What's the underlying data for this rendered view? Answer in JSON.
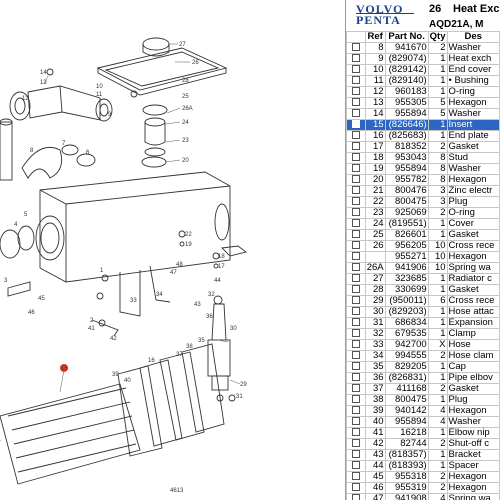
{
  "diagram": {
    "number": "4613",
    "callouts": [
      "27",
      "26",
      "28",
      "25",
      "26A",
      "24",
      "23",
      "20",
      "22",
      "19",
      "18",
      "17",
      "16",
      "15",
      "14",
      "13",
      "12",
      "11",
      "10",
      "9",
      "8",
      "7",
      "6",
      "5",
      "4",
      "3",
      "2",
      "1",
      "29",
      "30",
      "31",
      "32",
      "33",
      "34",
      "35",
      "36",
      "37",
      "38",
      "39",
      "40",
      "41",
      "42",
      "43",
      "44",
      "45",
      "46",
      "47",
      "48"
    ],
    "highlighted_callout": "15"
  },
  "brand": {
    "line1": "VOLVO",
    "line2": "PENTA"
  },
  "section": {
    "number": "26",
    "title": "Heat Exch",
    "subtitle": "AQD21A, M"
  },
  "columns": {
    "ref": "Ref",
    "part": "Part No.",
    "qty": "Qty",
    "desc": "Des"
  },
  "rows": [
    {
      "ref": "8",
      "part": "941670",
      "qty": "2",
      "desc": "Washer"
    },
    {
      "ref": "9",
      "part": "(829074)",
      "qty": "1",
      "desc": "Heat exch"
    },
    {
      "ref": "10",
      "part": "(829142)",
      "qty": "1",
      "desc": "End cover"
    },
    {
      "ref": "11",
      "part": "(829140)",
      "qty": "1",
      "desc": "• Bushing"
    },
    {
      "ref": "12",
      "part": "960183",
      "qty": "1",
      "desc": "O-ring"
    },
    {
      "ref": "13",
      "part": "955305",
      "qty": "5",
      "desc": "Hexagon"
    },
    {
      "ref": "14",
      "part": "955894",
      "qty": "5",
      "desc": "Washer"
    },
    {
      "ref": "15",
      "part": "(826646)",
      "qty": "1",
      "desc": "Insert",
      "selected": true
    },
    {
      "ref": "16",
      "part": "(825683)",
      "qty": "1",
      "desc": "End plate"
    },
    {
      "ref": "17",
      "part": "818352",
      "qty": "2",
      "desc": "Gasket"
    },
    {
      "ref": "18",
      "part": "953043",
      "qty": "8",
      "desc": "Stud"
    },
    {
      "ref": "19",
      "part": "955894",
      "qty": "8",
      "desc": "Washer"
    },
    {
      "ref": "20",
      "part": "955782",
      "qty": "8",
      "desc": "Hexagon"
    },
    {
      "ref": "21",
      "part": "800476",
      "qty": "3",
      "desc": "Zinc electr"
    },
    {
      "ref": "22",
      "part": "800475",
      "qty": "3",
      "desc": "Plug"
    },
    {
      "ref": "23",
      "part": "925069",
      "qty": "2",
      "desc": "O-ring"
    },
    {
      "ref": "24",
      "part": "(819551)",
      "qty": "1",
      "desc": "Cover"
    },
    {
      "ref": "25",
      "part": "826601",
      "qty": "1",
      "desc": "Gasket"
    },
    {
      "ref": "26",
      "part": "956205",
      "qty": "10",
      "desc": "Cross rece"
    },
    {
      "ref": "",
      "part": "955271",
      "qty": "10",
      "desc": "Hexagon"
    },
    {
      "ref": "26A",
      "part": "941906",
      "qty": "10",
      "desc": "Spring wa"
    },
    {
      "ref": "27",
      "part": "323685",
      "qty": "1",
      "desc": "Radiator c"
    },
    {
      "ref": "28",
      "part": "330699",
      "qty": "1",
      "desc": "Gasket"
    },
    {
      "ref": "29",
      "part": "(950011)",
      "qty": "6",
      "desc": "Cross rece"
    },
    {
      "ref": "30",
      "part": "(829203)",
      "qty": "1",
      "desc": "Hose attac"
    },
    {
      "ref": "31",
      "part": "686834",
      "qty": "1",
      "desc": "Expansion"
    },
    {
      "ref": "32",
      "part": "679535",
      "qty": "1",
      "desc": "Clamp"
    },
    {
      "ref": "33",
      "part": "942700",
      "qty": "X",
      "desc": "Hose"
    },
    {
      "ref": "34",
      "part": "994555",
      "qty": "2",
      "desc": "Hose clam"
    },
    {
      "ref": "35",
      "part": "829205",
      "qty": "1",
      "desc": "Cap"
    },
    {
      "ref": "36",
      "part": "(826831)",
      "qty": "1",
      "desc": "Pipe elbov"
    },
    {
      "ref": "37",
      "part": "411168",
      "qty": "2",
      "desc": "Gasket"
    },
    {
      "ref": "38",
      "part": "800475",
      "qty": "1",
      "desc": "Plug"
    },
    {
      "ref": "39",
      "part": "940142",
      "qty": "4",
      "desc": "Hexagon"
    },
    {
      "ref": "40",
      "part": "955894",
      "qty": "4",
      "desc": "Washer"
    },
    {
      "ref": "41",
      "part": "16218",
      "qty": "1",
      "desc": "Elbow nip"
    },
    {
      "ref": "42",
      "part": "82744",
      "qty": "2",
      "desc": "Shut-off c"
    },
    {
      "ref": "43",
      "part": "(818357)",
      "qty": "1",
      "desc": "Bracket"
    },
    {
      "ref": "44",
      "part": "(818393)",
      "qty": "1",
      "desc": "Spacer"
    },
    {
      "ref": "45",
      "part": "955318",
      "qty": "2",
      "desc": "Hexagon"
    },
    {
      "ref": "46",
      "part": "955319",
      "qty": "2",
      "desc": "Hexagon"
    },
    {
      "ref": "47",
      "part": "941908",
      "qty": "4",
      "desc": "Spring wa"
    }
  ]
}
